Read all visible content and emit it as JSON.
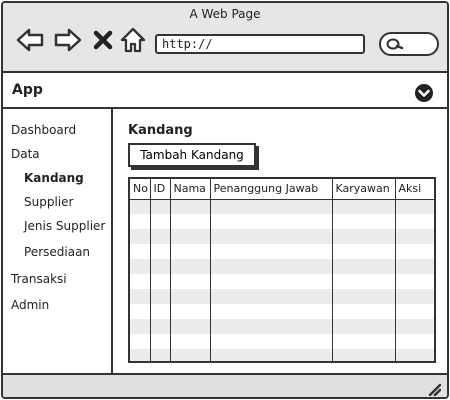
{
  "browser": {
    "title": "A Web Page",
    "url": "http://",
    "icons": [
      "back-arrow-icon",
      "forward-arrow-icon",
      "close-x-icon",
      "home-icon",
      "search-icon"
    ]
  },
  "app": {
    "title": "App",
    "menu_icon": "chevron-down-circle-icon"
  },
  "sidebar": {
    "items": [
      {
        "label": "Dashboard"
      },
      {
        "label": "Data"
      },
      {
        "label": "Kandang"
      },
      {
        "label": "Supplier"
      },
      {
        "label": "Jenis Supplier"
      },
      {
        "label": "Persediaan"
      },
      {
        "label": "Transaksi"
      },
      {
        "label": "Admin"
      }
    ]
  },
  "main": {
    "title": "Kandang",
    "add_button_label": "Tambah Kandang",
    "table": {
      "columns": [
        "No",
        "ID",
        "Nama",
        "Penanggung Jawab",
        "Karyawan",
        "Aksi"
      ],
      "rows": [
        [],
        [],
        [],
        [],
        [],
        [],
        [],
        [],
        [],
        [],
        []
      ]
    }
  },
  "colors": {
    "stroke": "#333333",
    "chrome_bg": "#e6e6e6",
    "row_alt": "#ececec"
  }
}
